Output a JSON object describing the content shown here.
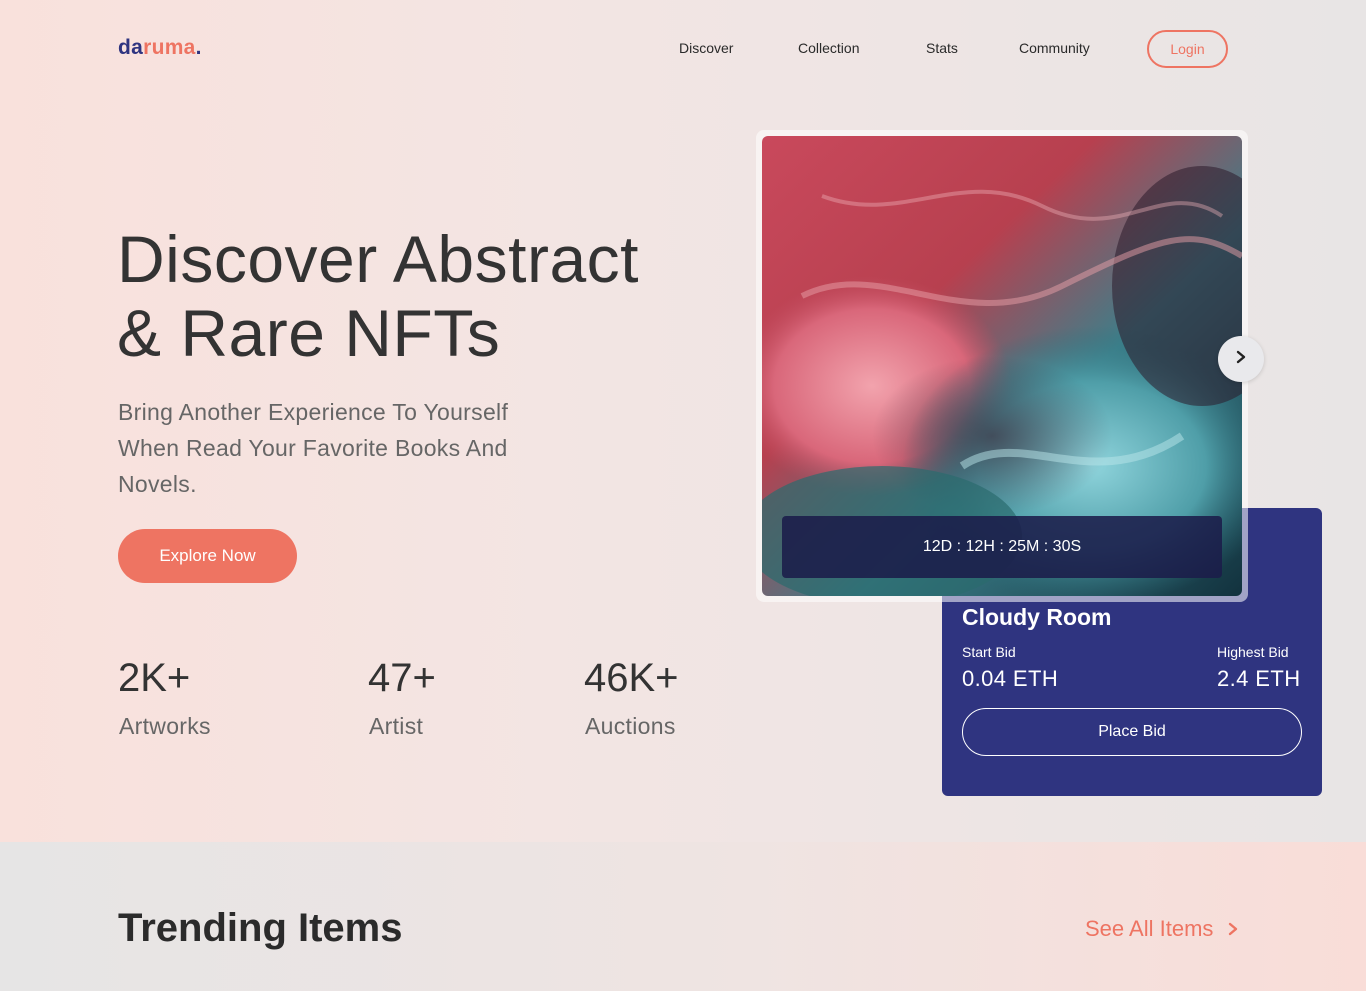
{
  "header": {
    "logo": {
      "part1": "da",
      "part2": "ruma",
      "dot": "."
    },
    "nav": [
      {
        "label": "Discover"
      },
      {
        "label": "Collection"
      },
      {
        "label": "Stats"
      },
      {
        "label": "Community"
      }
    ],
    "login_label": "Login"
  },
  "hero": {
    "title_line1": "Discover Abstract",
    "title_line2": "& Rare NFTs",
    "subtitle": "Bring Another Experience To Yourself When Read Your Favorite Books And Novels.",
    "cta_label": "Explore Now"
  },
  "stats": [
    {
      "value": "2K+",
      "label": "Artworks"
    },
    {
      "value": "47+",
      "label": "Artist"
    },
    {
      "value": "46K+",
      "label": "Auctions"
    }
  ],
  "featured": {
    "timer": "12D : 12H : 25M : 30S",
    "name": "Cloudy Room",
    "start_bid_label": "Start Bid",
    "start_bid_value": "0.04 ETH",
    "highest_bid_label": "Highest Bid",
    "highest_bid_value": "2.4 ETH",
    "place_bid_label": "Place Bid"
  },
  "trending": {
    "title": "Trending Items",
    "see_all_label": "See All Items"
  },
  "colors": {
    "accent": "#ee7462",
    "brand": "#2f3480"
  },
  "icons": {
    "next": "chevron-right-icon",
    "see_all": "chevron-right-icon"
  }
}
